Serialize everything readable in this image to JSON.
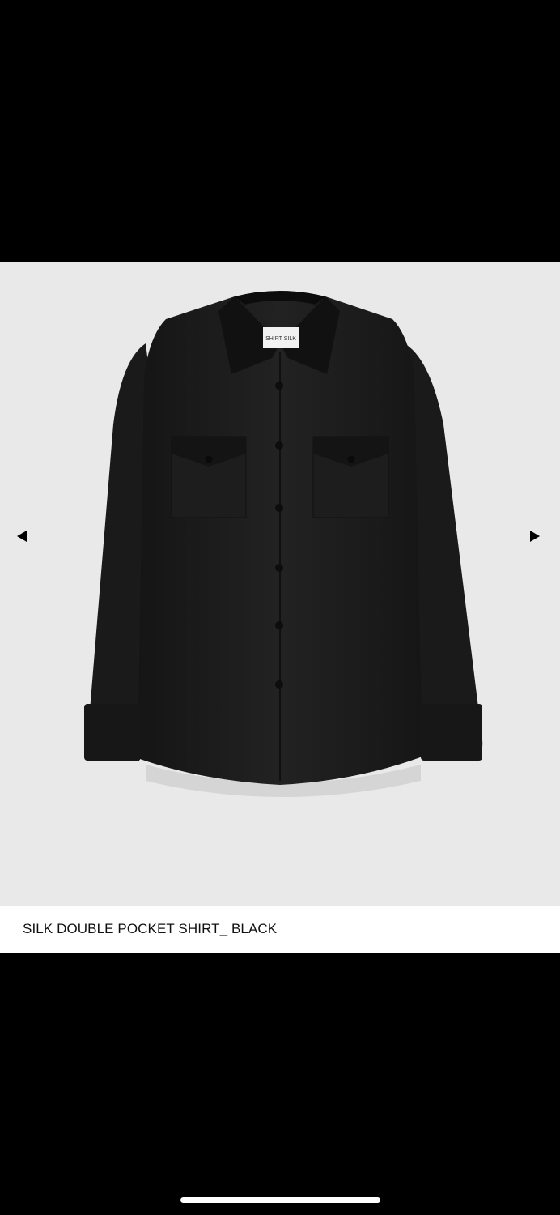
{
  "product": {
    "title": "SILK DOUBLE POCKET SHIRT_ BLACK",
    "image_subject": "black silk shirt with two flap chest pockets",
    "label_text": "SHIRT SILK"
  },
  "gallery": {
    "prev_icon": "triangle-left",
    "next_icon": "triangle-right"
  },
  "colors": {
    "background": "#000000",
    "gallery_bg": "#e9e9e9",
    "caption_bg": "#ffffff",
    "garment": "#1b1b1b"
  }
}
